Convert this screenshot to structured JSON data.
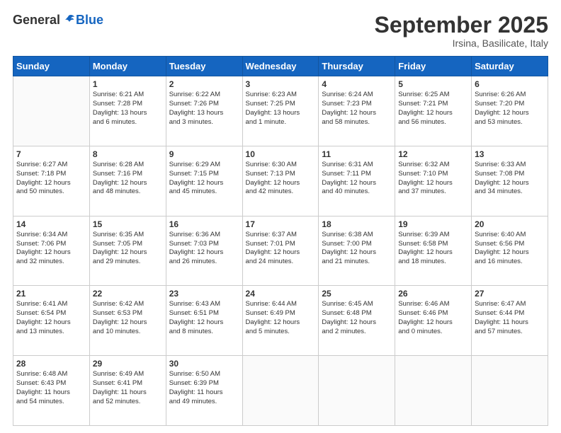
{
  "header": {
    "logo_general": "General",
    "logo_blue": "Blue",
    "month_title": "September 2025",
    "subtitle": "Irsina, Basilicate, Italy"
  },
  "calendar": {
    "days_of_week": [
      "Sunday",
      "Monday",
      "Tuesday",
      "Wednesday",
      "Thursday",
      "Friday",
      "Saturday"
    ],
    "weeks": [
      [
        {
          "day": "",
          "content": ""
        },
        {
          "day": "1",
          "content": "Sunrise: 6:21 AM\nSunset: 7:28 PM\nDaylight: 13 hours\nand 6 minutes."
        },
        {
          "day": "2",
          "content": "Sunrise: 6:22 AM\nSunset: 7:26 PM\nDaylight: 13 hours\nand 3 minutes."
        },
        {
          "day": "3",
          "content": "Sunrise: 6:23 AM\nSunset: 7:25 PM\nDaylight: 13 hours\nand 1 minute."
        },
        {
          "day": "4",
          "content": "Sunrise: 6:24 AM\nSunset: 7:23 PM\nDaylight: 12 hours\nand 58 minutes."
        },
        {
          "day": "5",
          "content": "Sunrise: 6:25 AM\nSunset: 7:21 PM\nDaylight: 12 hours\nand 56 minutes."
        },
        {
          "day": "6",
          "content": "Sunrise: 6:26 AM\nSunset: 7:20 PM\nDaylight: 12 hours\nand 53 minutes."
        }
      ],
      [
        {
          "day": "7",
          "content": "Sunrise: 6:27 AM\nSunset: 7:18 PM\nDaylight: 12 hours\nand 50 minutes."
        },
        {
          "day": "8",
          "content": "Sunrise: 6:28 AM\nSunset: 7:16 PM\nDaylight: 12 hours\nand 48 minutes."
        },
        {
          "day": "9",
          "content": "Sunrise: 6:29 AM\nSunset: 7:15 PM\nDaylight: 12 hours\nand 45 minutes."
        },
        {
          "day": "10",
          "content": "Sunrise: 6:30 AM\nSunset: 7:13 PM\nDaylight: 12 hours\nand 42 minutes."
        },
        {
          "day": "11",
          "content": "Sunrise: 6:31 AM\nSunset: 7:11 PM\nDaylight: 12 hours\nand 40 minutes."
        },
        {
          "day": "12",
          "content": "Sunrise: 6:32 AM\nSunset: 7:10 PM\nDaylight: 12 hours\nand 37 minutes."
        },
        {
          "day": "13",
          "content": "Sunrise: 6:33 AM\nSunset: 7:08 PM\nDaylight: 12 hours\nand 34 minutes."
        }
      ],
      [
        {
          "day": "14",
          "content": "Sunrise: 6:34 AM\nSunset: 7:06 PM\nDaylight: 12 hours\nand 32 minutes."
        },
        {
          "day": "15",
          "content": "Sunrise: 6:35 AM\nSunset: 7:05 PM\nDaylight: 12 hours\nand 29 minutes."
        },
        {
          "day": "16",
          "content": "Sunrise: 6:36 AM\nSunset: 7:03 PM\nDaylight: 12 hours\nand 26 minutes."
        },
        {
          "day": "17",
          "content": "Sunrise: 6:37 AM\nSunset: 7:01 PM\nDaylight: 12 hours\nand 24 minutes."
        },
        {
          "day": "18",
          "content": "Sunrise: 6:38 AM\nSunset: 7:00 PM\nDaylight: 12 hours\nand 21 minutes."
        },
        {
          "day": "19",
          "content": "Sunrise: 6:39 AM\nSunset: 6:58 PM\nDaylight: 12 hours\nand 18 minutes."
        },
        {
          "day": "20",
          "content": "Sunrise: 6:40 AM\nSunset: 6:56 PM\nDaylight: 12 hours\nand 16 minutes."
        }
      ],
      [
        {
          "day": "21",
          "content": "Sunrise: 6:41 AM\nSunset: 6:54 PM\nDaylight: 12 hours\nand 13 minutes."
        },
        {
          "day": "22",
          "content": "Sunrise: 6:42 AM\nSunset: 6:53 PM\nDaylight: 12 hours\nand 10 minutes."
        },
        {
          "day": "23",
          "content": "Sunrise: 6:43 AM\nSunset: 6:51 PM\nDaylight: 12 hours\nand 8 minutes."
        },
        {
          "day": "24",
          "content": "Sunrise: 6:44 AM\nSunset: 6:49 PM\nDaylight: 12 hours\nand 5 minutes."
        },
        {
          "day": "25",
          "content": "Sunrise: 6:45 AM\nSunset: 6:48 PM\nDaylight: 12 hours\nand 2 minutes."
        },
        {
          "day": "26",
          "content": "Sunrise: 6:46 AM\nSunset: 6:46 PM\nDaylight: 12 hours\nand 0 minutes."
        },
        {
          "day": "27",
          "content": "Sunrise: 6:47 AM\nSunset: 6:44 PM\nDaylight: 11 hours\nand 57 minutes."
        }
      ],
      [
        {
          "day": "28",
          "content": "Sunrise: 6:48 AM\nSunset: 6:43 PM\nDaylight: 11 hours\nand 54 minutes."
        },
        {
          "day": "29",
          "content": "Sunrise: 6:49 AM\nSunset: 6:41 PM\nDaylight: 11 hours\nand 52 minutes."
        },
        {
          "day": "30",
          "content": "Sunrise: 6:50 AM\nSunset: 6:39 PM\nDaylight: 11 hours\nand 49 minutes."
        },
        {
          "day": "",
          "content": ""
        },
        {
          "day": "",
          "content": ""
        },
        {
          "day": "",
          "content": ""
        },
        {
          "day": "",
          "content": ""
        }
      ]
    ]
  }
}
